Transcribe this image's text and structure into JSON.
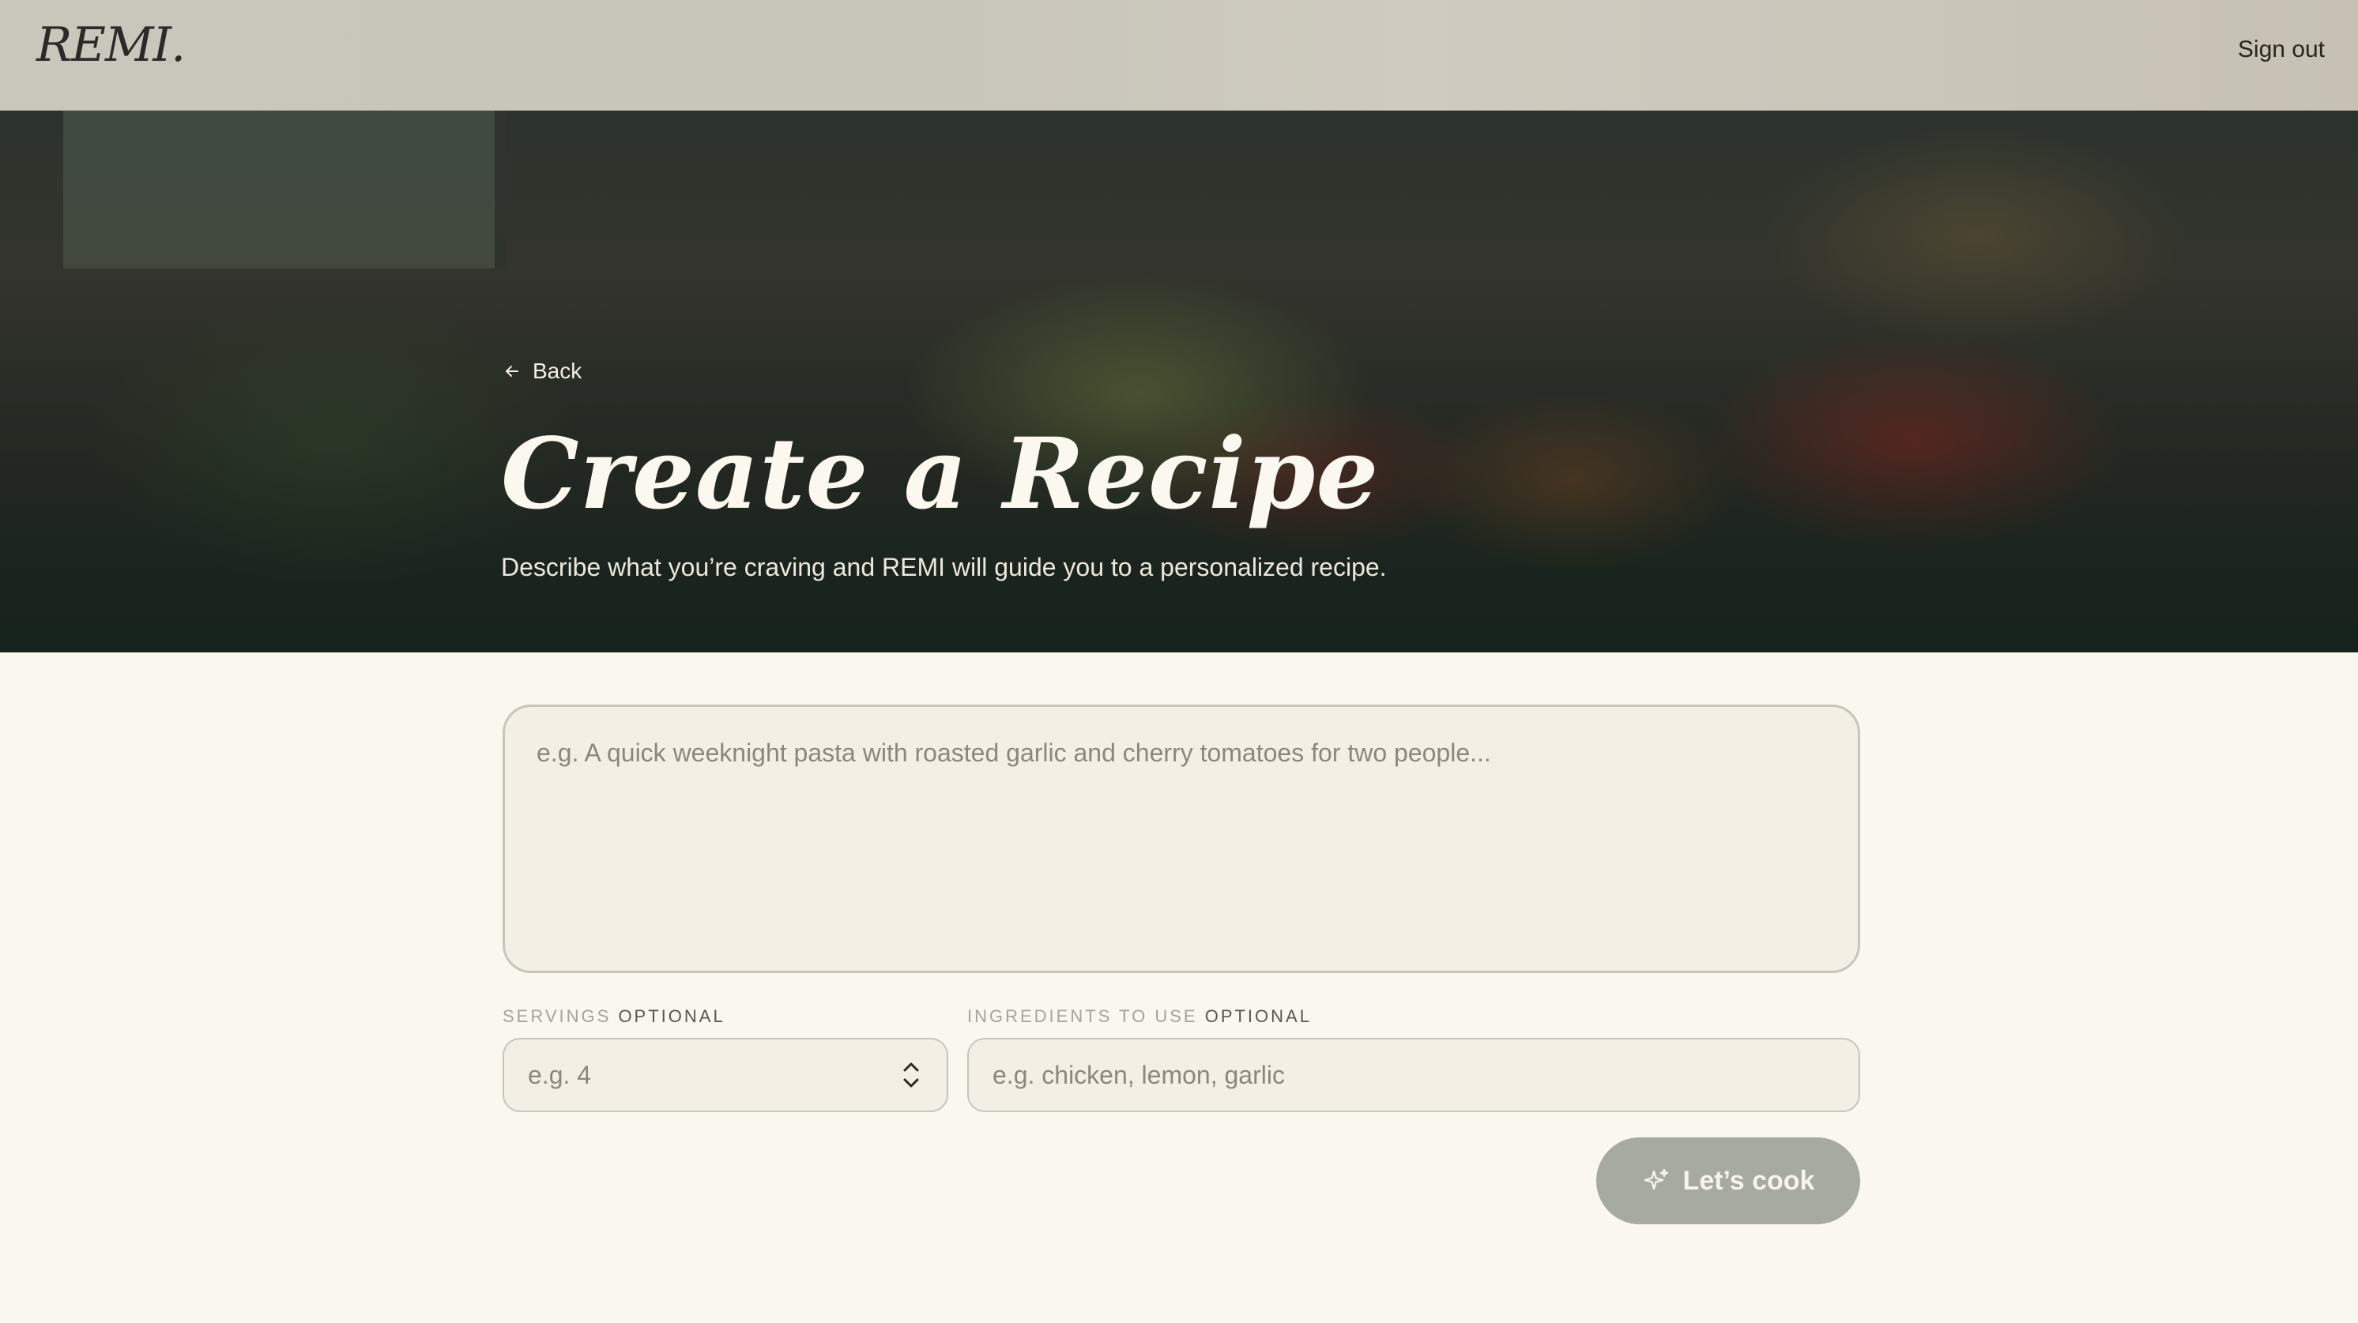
{
  "header": {
    "logo": "REMI.",
    "sign_out": "Sign out"
  },
  "hero": {
    "back_label": "Back",
    "title": "Create a Recipe",
    "subtitle": "Describe what you’re craving and REMI will guide you to a personalized recipe."
  },
  "form": {
    "prompt_placeholder": "e.g. A quick weeknight pasta with roasted garlic and cherry tomatoes for two people...",
    "servings": {
      "label": "SERVINGS",
      "optional": "OPTIONAL",
      "placeholder": "e.g. 4"
    },
    "ingredients": {
      "label": "INGREDIENTS TO USE",
      "optional": "OPTIONAL",
      "placeholder": "e.g. chicken, lemon, garlic"
    },
    "submit_label": "Let’s cook"
  },
  "icons": {
    "back": "arrow-left-icon",
    "stepper": "chevron-up-down-icon",
    "submit": "sparkle-icon"
  },
  "colors": {
    "background": "#faf7ee",
    "button": "#a7aa9f",
    "field_border": "#c8c5bb"
  }
}
